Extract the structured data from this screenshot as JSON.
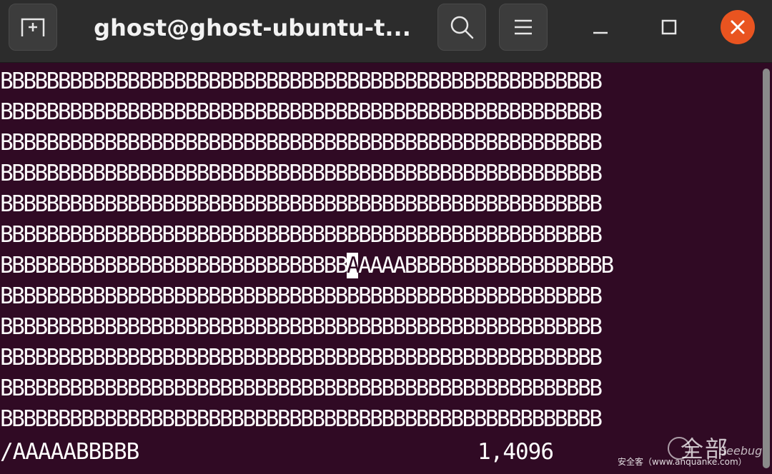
{
  "window": {
    "title": "ghost@ghost-ubuntu-t...",
    "accent_close": "#e95420",
    "terminal_bg": "#300a24",
    "headerbar_bg": "#2c2c2c"
  },
  "headerbar": {
    "new_tab_icon": "new-tab-icon",
    "search_icon": "search-icon",
    "menu_icon": "hamburger-menu-icon",
    "minimize_icon": "minimize-icon",
    "maximize_icon": "maximize-icon",
    "close_icon": "close-icon"
  },
  "terminal": {
    "lines": [
      "BBBBBBBBBBBBBBBBBBBBBBBBBBBBBBBBBBBBBBBBBBBBBBBBBBBB",
      "BBBBBBBBBBBBBBBBBBBBBBBBBBBBBBBBBBBBBBBBBBBBBBBBBBBB",
      "BBBBBBBBBBBBBBBBBBBBBBBBBBBBBBBBBBBBBBBBBBBBBBBBBBBB",
      "BBBBBBBBBBBBBBBBBBBBBBBBBBBBBBBBBBBBBBBBBBBBBBBBBBBB",
      "BBBBBBBBBBBBBBBBBBBBBBBBBBBBBBBBBBBBBBBBBBBBBBBBBBBB",
      "BBBBBBBBBBBBBBBBBBBBBBBBBBBBBBBBBBBBBBBBBBBBBBBBBBBB",
      "BBBBBBBBBBBBBBBBBBBBBBBBBBBBBB",
      "BBBBBBBBBBBBBBBBBBBBBBBBBBBBBBBBBBBBBBBBBBBBBBBBBBBB",
      "BBBBBBBBBBBBBBBBBBBBBBBBBBBBBBBBBBBBBBBBBBBBBBBBBBBB",
      "BBBBBBBBBBBBBBBBBBBBBBBBBBBBBBBBBBBBBBBBBBBBBBBBBBBB",
      "BBBBBBBBBBBBBBBBBBBBBBBBBBBBBBBBBBBBBBBBBBBBBBBBBBBB",
      "BBBBBBBBBBBBBBBBBBBBBBBBBBBBBBBBBBBBBBBBBBBBBBBBBBBB"
    ],
    "cursor_char": "A",
    "cursor_line_after": "AAAABBBBBBBBBBBBBBBBBB",
    "search_command": "/AAAAABBBBB",
    "cursor_position": "1,4096"
  },
  "watermark": {
    "logo_text": "全部",
    "brand": "Seebug",
    "caption": "安全客（www.anquanke.com）"
  }
}
